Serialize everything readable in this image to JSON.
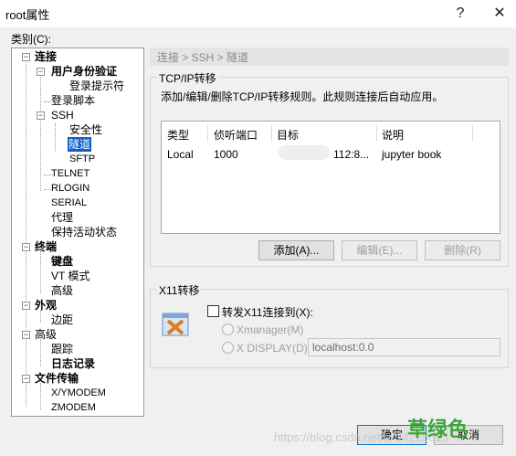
{
  "window": {
    "title": "root属性",
    "help": "?",
    "close": "✕"
  },
  "category_label": "类别(C):",
  "tree": {
    "connect": "连接",
    "auth": "用户身份验证",
    "login_prompt": "登录提示符",
    "login_script": "登录脚本",
    "ssh": "SSH",
    "security": "安全性",
    "tunnel": "隧道",
    "sftp": "SFTP",
    "telnet": "TELNET",
    "rlogin": "RLOGIN",
    "serial": "SERIAL",
    "proxy": "代理",
    "keepalive": "保持活动状态",
    "terminal": "终端",
    "keyboard": "键盘",
    "vt_mode": "VT 模式",
    "advanced": "高级",
    "appearance": "外观",
    "margin": "边距",
    "advanced2": "高级",
    "trace": "跟踪",
    "logging": "日志记录",
    "file_transfer": "文件传输",
    "xymodem": "X/YMODEM",
    "zmodem": "ZMODEM"
  },
  "breadcrumb": "连接 > SSH > 隧道",
  "tcp": {
    "group": "TCP/IP转移",
    "desc": "添加/编辑/删除TCP/IP转移规则。此规则连接后自动应用。",
    "columns": [
      "类型",
      "侦听端口",
      "目标",
      "说明"
    ],
    "rows": [
      {
        "type": "Local",
        "port": "1000",
        "target": "112:8...",
        "note": "jupyter book"
      }
    ],
    "add": "添加(A)...",
    "edit": "编辑(E)...",
    "delete": "删除(R)"
  },
  "x11": {
    "group": "X11转移",
    "forward": "转发X11连接到(X):",
    "xmanager": "Xmanager(M)",
    "xdisplay": "X DISPLAY(D):",
    "display_value": "localhost:0.0"
  },
  "footer": {
    "ok": "确定",
    "cancel": "取消"
  },
  "watermark": "https://blog.csdn.net/lz 14225615",
  "overlay_text": "草绿色"
}
